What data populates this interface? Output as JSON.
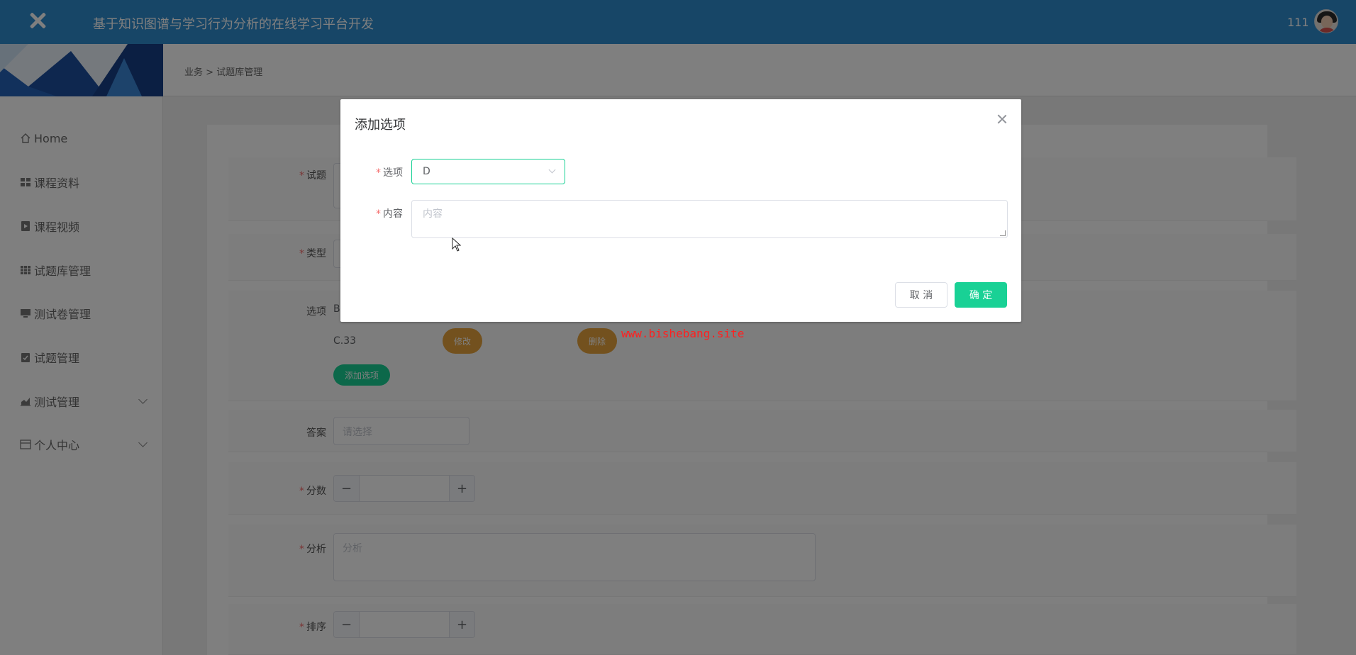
{
  "header": {
    "title": "基于知识图谱与学习行为分析的在线学习平台开发",
    "username": "111",
    "brand_color": "#2e8ccf"
  },
  "breadcrumb": {
    "items": [
      "业务",
      "试题库管理"
    ],
    "separator": ">"
  },
  "sidebar": {
    "items": [
      {
        "label": "Home",
        "icon": "home-icon"
      },
      {
        "label": "课程资料",
        "icon": "grid-icon"
      },
      {
        "label": "课程视频",
        "icon": "video-icon"
      },
      {
        "label": "试题库管理",
        "icon": "table-icon"
      },
      {
        "label": "测试卷管理",
        "icon": "monitor-icon"
      },
      {
        "label": "试题管理",
        "icon": "clipboard-icon"
      },
      {
        "label": "测试管理",
        "icon": "chart-icon",
        "expandable": true
      },
      {
        "label": "个人中心",
        "icon": "id-card-icon",
        "expandable": true
      }
    ]
  },
  "form": {
    "question_label": "试题",
    "type_label": "类型",
    "options_label": "选项",
    "option_b_text": "B",
    "option_c_text": "C.33",
    "edit_label": "修改",
    "delete_label": "删除",
    "add_option_label": "添加选项",
    "answer_label": "答案",
    "answer_placeholder": "请选择",
    "score_label": "分数",
    "analysis_label": "分析",
    "analysis_placeholder": "分析",
    "sort_label": "排序",
    "minus": "−",
    "plus": "+",
    "required_mark": "*"
  },
  "modal": {
    "title": "添加选项",
    "option_label": "选项",
    "option_value": "D",
    "content_label": "内容",
    "content_placeholder": "内容",
    "cancel_label": "取 消",
    "confirm_label": "确 定",
    "accent_color": "#19d195"
  },
  "watermark": "www.bishebang.site"
}
